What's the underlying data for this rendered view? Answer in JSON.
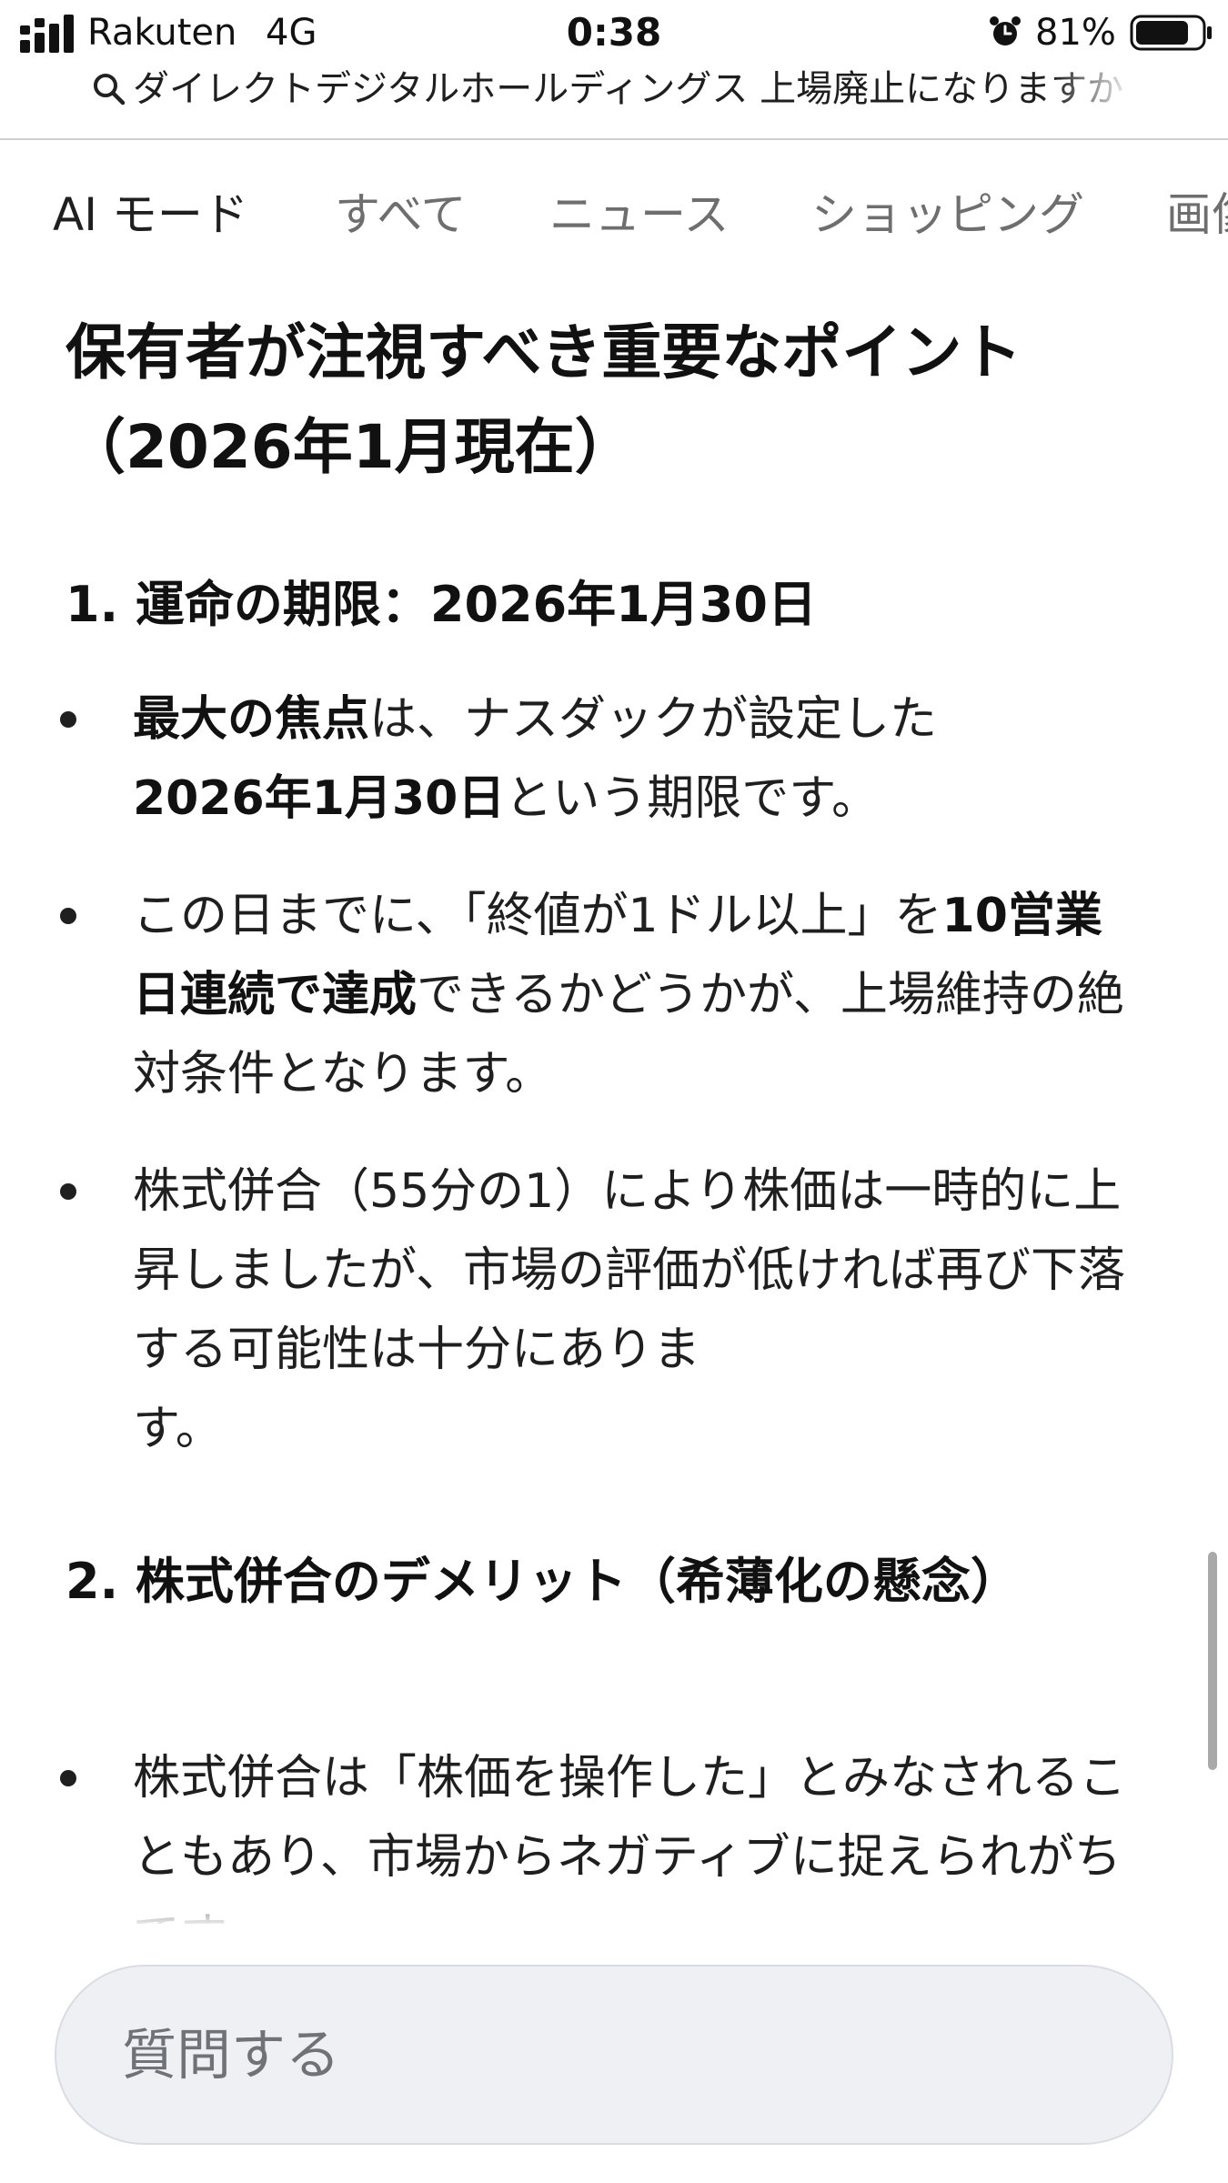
{
  "status_bar": {
    "carrier": "Rakuten",
    "network": "4G",
    "time": "0:38",
    "battery_percent": "81%",
    "battery_level": 0.81,
    "icons": [
      "signal-icon",
      "alarm-icon",
      "battery-icon"
    ]
  },
  "query_bar": {
    "icon": "search-icon",
    "query": "ダイレクトデジタルホールディングス 上場廃止になりますか"
  },
  "tabs": [
    {
      "label": "AI モード",
      "active": true
    },
    {
      "label": "すべて",
      "active": false
    },
    {
      "label": "ニュース",
      "active": false
    },
    {
      "label": "ショッピング",
      "active": false
    },
    {
      "label": "画像",
      "active": false
    }
  ],
  "content": {
    "heading_line1": "保有者が注視すべき重要なポイント",
    "heading_line2": "（2026年1月現在）",
    "section1": {
      "title": "1. 運命の期限：2026年1月30日",
      "bullet1": {
        "strong1": "最大の焦点",
        "text1": "は、ナスダックが設定した",
        "strong2": "2026年1月30日",
        "text2": "という期限です。"
      },
      "bullet2": {
        "text1": "この日までに、「終値が1ドル以上」を",
        "strong1": "10営業日連続で達成",
        "text2": "できるかどうかが、上場維持の絶対条件となります。"
      },
      "bullet3": {
        "text1": "株式併合（55分の1）により株価は一時的に上昇しましたが、市場の評価が低ければ再び下落する可能性は十分にありま",
        "text2": "す。"
      }
    },
    "section2": {
      "title": "2. 株式併合のデメリット（希薄化の懸念）",
      "bullet1": {
        "text1": "株式併合は「株価を操作した」とみなされることもあり、市場からネガティブに捉えられがちです。"
      }
    }
  },
  "ask_bar": {
    "placeholder": "質問する"
  },
  "colors": {
    "text_primary": "#1f1f1f",
    "text_secondary": "#6e6e6e",
    "ask_bar_bg": "#eef0f4",
    "divider": "#cfcfcf",
    "scrollbar": "#a9a9a9"
  }
}
